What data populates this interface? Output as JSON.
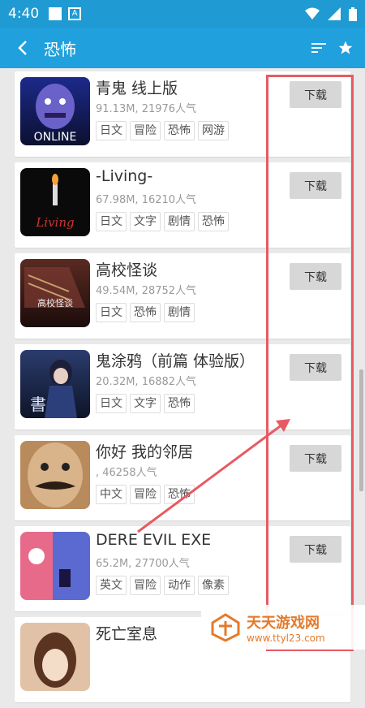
{
  "status": {
    "time": "4:40"
  },
  "app_bar": {
    "title": "恐怖"
  },
  "games": [
    {
      "title": "青鬼 线上版",
      "meta": "91.13M, 21976人气",
      "tags": [
        "日文",
        "冒险",
        "恐怖",
        "网游"
      ],
      "download": "下载",
      "thumb_text": "ONLINE"
    },
    {
      "title": "-Living-",
      "meta": "67.98M, 16210人气",
      "tags": [
        "日文",
        "文字",
        "剧情",
        "恐怖"
      ],
      "download": "下载",
      "thumb_text": "Living"
    },
    {
      "title": "高校怪谈",
      "meta": "49.54M, 28752人气",
      "tags": [
        "日文",
        "恐怖",
        "剧情"
      ],
      "download": "下载",
      "thumb_text": "高校怪谈"
    },
    {
      "title": "鬼涂鸦（前篇 体验版）",
      "meta": "20.32M, 16882人气",
      "tags": [
        "日文",
        "文字",
        "恐怖"
      ],
      "download": "下载",
      "thumb_text": "書"
    },
    {
      "title": "你好 我的邻居",
      "meta": ", 46258人气",
      "tags": [
        "中文",
        "冒险",
        "恐怖"
      ],
      "download": "下载",
      "thumb_text": ""
    },
    {
      "title": "DERE EVIL EXE",
      "meta": "65.2M, 27700人气",
      "tags": [
        "英文",
        "冒险",
        "动作",
        "像素"
      ],
      "download": "下载",
      "thumb_text": ""
    },
    {
      "title": "死亡室息",
      "meta": "",
      "tags": [],
      "download": "",
      "thumb_text": ""
    }
  ],
  "watermark": {
    "title": "天天游戏网",
    "url": "www.ttyl23.com"
  },
  "colors": {
    "status_bar": "#1f9ad3",
    "app_bar": "#20a0dc",
    "annotation": "#e85a63"
  },
  "icons": [
    "back-icon",
    "sort-icon",
    "star-icon",
    "wifi-icon",
    "signal-icon",
    "battery-icon"
  ]
}
